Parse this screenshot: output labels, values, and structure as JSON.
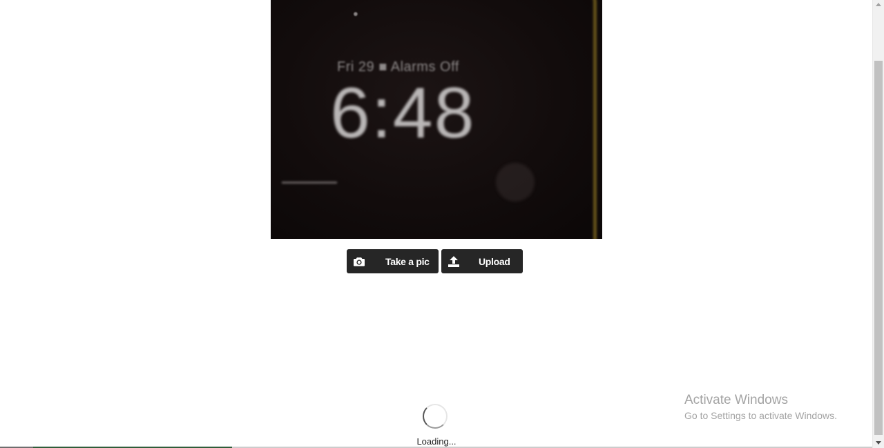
{
  "camera": {
    "lock_date": "Fri 29",
    "alarm_text": "Alarms Off",
    "lock_time": "6:48"
  },
  "toolbar": {
    "take_pic_label": "Take a pic",
    "upload_label": "Upload"
  },
  "loading": {
    "label": "Loading..."
  },
  "watermark": {
    "title": "Activate Windows",
    "subtitle": "Go to Settings to activate Windows."
  },
  "icons": {
    "take_pic": "camera-icon",
    "upload": "upload-icon"
  }
}
